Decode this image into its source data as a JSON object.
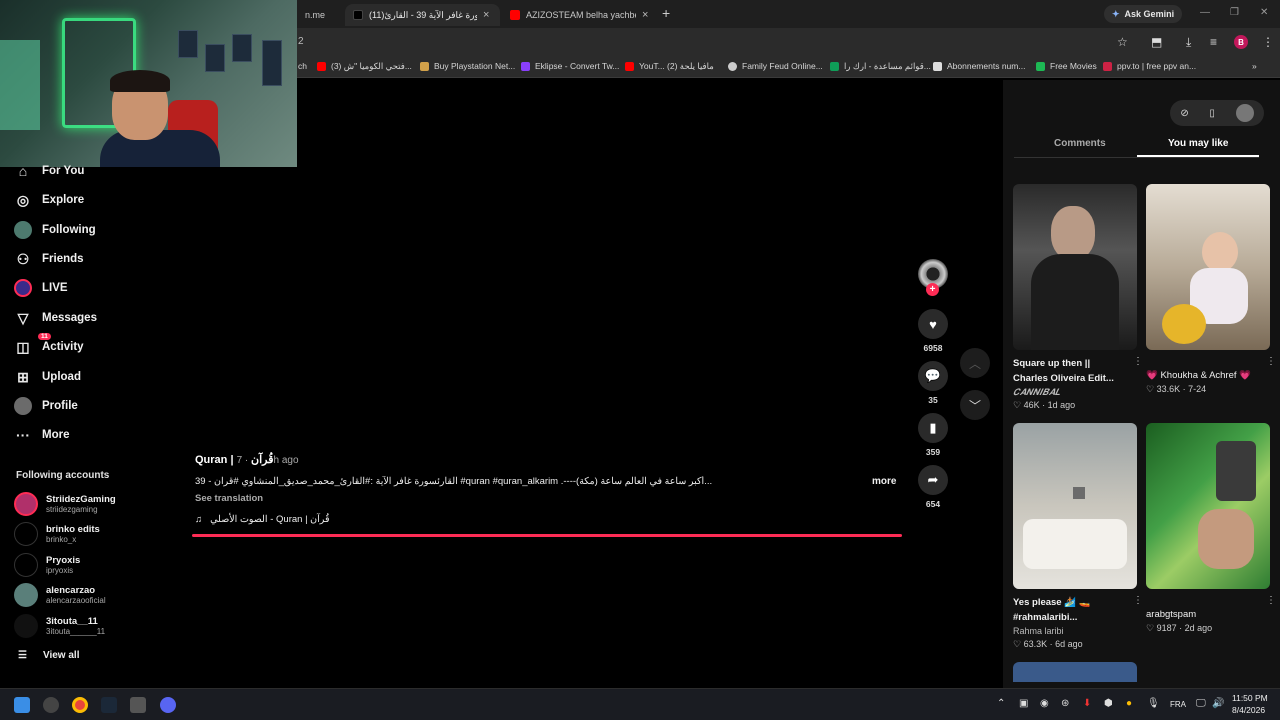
{
  "browser": {
    "tabs": [
      {
        "title": "n.me",
        "active": false
      },
      {
        "title": "(11)سورة غافر الآية 39 - القارئ",
        "active": true,
        "icon": "tiktok-icon"
      },
      {
        "title": "AZIZOSTEAM belha yachbe3 fi",
        "active": false,
        "icon": "youtube-icon"
      }
    ],
    "ask_gemini": "Ask Gemini",
    "address": "2",
    "profile_initial": "B",
    "bookmarks": [
      {
        "label": "ch",
        "color": "#777777"
      },
      {
        "label": "(3) فتحي الكوميا \"ش...",
        "color": "#ff0000"
      },
      {
        "label": "Buy Playstation Net...",
        "color": "#d2a14a"
      },
      {
        "label": "Eklipse - Convert Tw...",
        "color": "#8a3ffc"
      },
      {
        "label": "YouT... (2) مافيا يلحة",
        "color": "#ff0000"
      },
      {
        "label": "Family Feud Online...",
        "color": "#cccccc"
      },
      {
        "label": "قوائم مساعدة - ارك را...",
        "color": "#0f9d58"
      },
      {
        "label": "Abonnements num...",
        "color": "#dddddd"
      },
      {
        "label": "Free Movies",
        "color": "#1db954"
      },
      {
        "label": "ppv.to | free ppv an...",
        "color": "#cc2244"
      }
    ]
  },
  "sidebar": {
    "items": [
      {
        "label": "For You",
        "icon": "home-icon"
      },
      {
        "label": "Explore",
        "icon": "compass-icon"
      },
      {
        "label": "Following",
        "icon": "following-avatar"
      },
      {
        "label": "Friends",
        "icon": "friends-icon"
      },
      {
        "label": "LIVE",
        "icon": "live-icon"
      },
      {
        "label": "Messages",
        "icon": "messages-icon"
      },
      {
        "label": "Activity",
        "icon": "activity-icon",
        "badge": "11"
      },
      {
        "label": "Upload",
        "icon": "upload-icon"
      },
      {
        "label": "Profile",
        "icon": "profile-avatar"
      },
      {
        "label": "More",
        "icon": "more-icon"
      }
    ],
    "following_heading": "Following accounts",
    "accounts": [
      {
        "name": "StriidezGaming",
        "handle": "striidezgaming"
      },
      {
        "name": "brinko edits",
        "handle": "brinko_x"
      },
      {
        "name": "Pryoxis",
        "handle": "ipryoxis"
      },
      {
        "name": "alencarzao",
        "handle": "alencarzaooficial"
      },
      {
        "name": "3itouta__11",
        "handle": "3itouta______11"
      }
    ],
    "view_all": "View all"
  },
  "video": {
    "author": "Quran | قُرآن",
    "time": " · 7h ago",
    "description": "39 - القارئسورة غافر الآية :#القارئ_محمد_صديق_المنشاوي #قران #quran #quran_alkarim .----(مكة) أكبر ساعة في العالم ساعة...",
    "more": "more",
    "see_translation": "See translation",
    "music": "الصوت الأصلي - Quran | قُرآن",
    "likes": "6958",
    "comments": "35",
    "saves": "359",
    "shares": "654"
  },
  "right_panel": {
    "tabs": [
      "Comments",
      "You may like"
    ],
    "active_tab": "You may like",
    "cards": [
      {
        "title1": "Square up then ||",
        "title2": "Charles Oliveira Edit...",
        "author": "𝑪𝑨𝑵𝑵𝑰𝑩𝑨𝑳",
        "likes": "46K",
        "age": "1d ago"
      },
      {
        "title1": "💗 Khoukha & Achref 💗",
        "likes": "33.6K",
        "age": "7-24"
      },
      {
        "title1": "Yes please 🏄🏽 🚤",
        "title2": "#rahmalaribi...",
        "author": "Rahma laribi",
        "likes": "63.3K",
        "age": "6d ago"
      },
      {
        "title1": "arabgtspam",
        "likes": "9187",
        "age": "2d ago"
      }
    ]
  },
  "taskbar": {
    "lang": "FRA",
    "time": "11:50 PM",
    "date": "8/4/2026"
  }
}
